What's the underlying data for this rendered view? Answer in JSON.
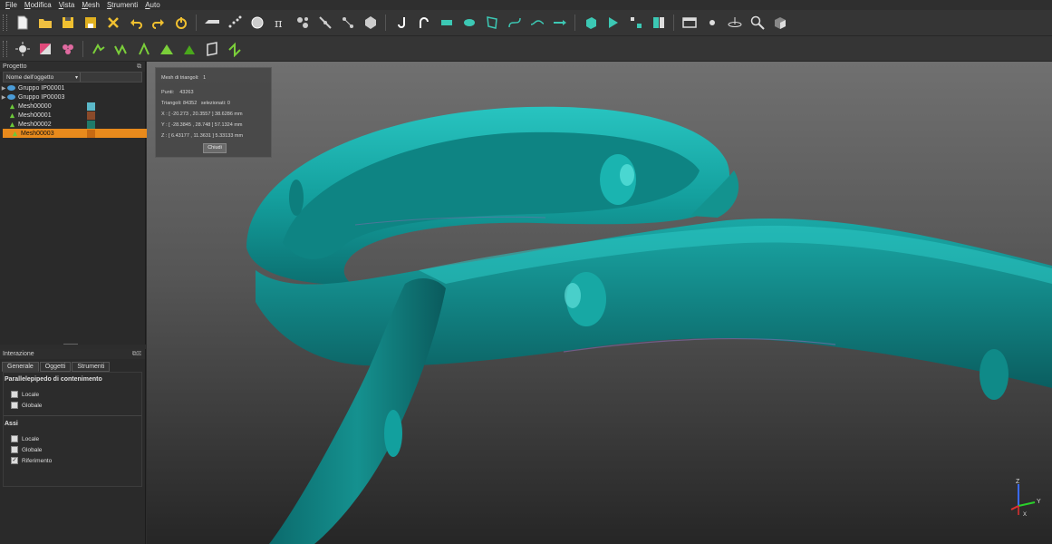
{
  "menu": [
    "File",
    "Modifica",
    "Vista",
    "Mesh",
    "Strumenti",
    "Auto"
  ],
  "project_panel": {
    "title": "Progetto",
    "column_header": "Nome dell'oggetto",
    "items": [
      {
        "label": "Gruppo IP00001",
        "kind": "group"
      },
      {
        "label": "Gruppo IP00003",
        "kind": "group"
      },
      {
        "label": "Mesh00000",
        "kind": "mesh",
        "color": "#5bb8c8"
      },
      {
        "label": "Mesh00001",
        "kind": "mesh",
        "color": "#8a4a2a"
      },
      {
        "label": "Mesh00002",
        "kind": "mesh",
        "color": "#1f7a6a"
      },
      {
        "label": "Mesh00003",
        "kind": "mesh",
        "color": "#e88a1c",
        "selected": true
      }
    ]
  },
  "interaction_panel": {
    "title": "Interazione",
    "tabs": [
      "Generale",
      "Oggetti",
      "Strumenti"
    ],
    "sections": [
      {
        "title": "Parallelepipedo di contenimento",
        "options": [
          {
            "label": "Locale",
            "checked": false
          },
          {
            "label": "Globale",
            "checked": false
          }
        ]
      },
      {
        "title": "Assi",
        "options": [
          {
            "label": "Locale",
            "checked": false
          },
          {
            "label": "Globale",
            "checked": false
          },
          {
            "label": "Riferimento",
            "checked": true
          }
        ]
      }
    ]
  },
  "info_box": {
    "mesh_count_label": "Mesh di triangoli:",
    "mesh_count": "1",
    "points_label": "Punti:",
    "points": "43263",
    "triangles_label": "Triangoli:",
    "triangles": "84352",
    "selected_label": "selezionati:",
    "selected": "0",
    "x_range": "X :  [ -20.273 , 20.3557 ]   38.6286 mm",
    "y_range": "Y :  [ -28.3845 , 28.748 ]   57.1324 mm",
    "z_range": "Z :  [ 6.43177 , 11.3631 ]   5.33133 mm",
    "close_label": "Chiudi"
  },
  "axes": {
    "x": "X",
    "y": "Y",
    "z": "Z"
  },
  "colors": {
    "mesh": "#0f8e8e",
    "mesh_highlight": "#2fd0cc",
    "selection": "#e88a1c"
  }
}
